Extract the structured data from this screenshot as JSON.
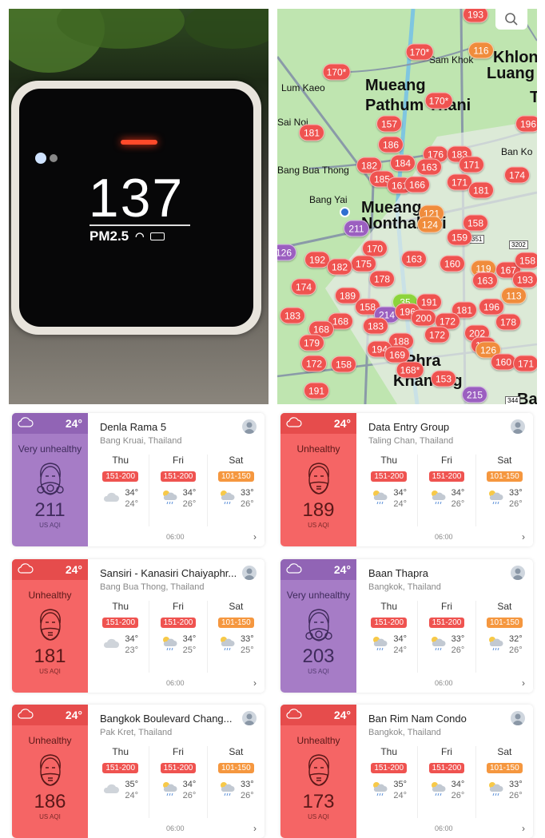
{
  "photo": {
    "reading": "137",
    "pollutant": "PM2.5"
  },
  "map": {
    "search_icon": "search-icon",
    "colors": {
      "red": "#ef5350",
      "orange": "#f08c3c",
      "purple": "#9b5fc0",
      "green": "#8cd43c"
    },
    "labels": [
      "Mueang",
      "Pathum Thani",
      "Lum Kaeo",
      "Sai Noi",
      "Sam Khok",
      "Khlong",
      "Luang",
      "Bang Bua Thong",
      "Bang Yai",
      "Mueang",
      "Nonthaburi",
      "Ban Ko",
      "Phra",
      "Khanong",
      "Ba",
      "T"
    ],
    "road_numbers": [
      "351",
      "3202",
      "344"
    ],
    "markers": [
      {
        "v": "193",
        "c": "red"
      },
      {
        "v": "170*",
        "c": "red"
      },
      {
        "v": "116",
        "c": "orange"
      },
      {
        "v": "170*",
        "c": "red"
      },
      {
        "v": "170*",
        "c": "red"
      },
      {
        "v": "157",
        "c": "red"
      },
      {
        "v": "181",
        "c": "red"
      },
      {
        "v": "196",
        "c": "red"
      },
      {
        "v": "186",
        "c": "red"
      },
      {
        "v": "182",
        "c": "red"
      },
      {
        "v": "176",
        "c": "red"
      },
      {
        "v": "183",
        "c": "red"
      },
      {
        "v": "184",
        "c": "red"
      },
      {
        "v": "163",
        "c": "red"
      },
      {
        "v": "171",
        "c": "red"
      },
      {
        "v": "174",
        "c": "red"
      },
      {
        "v": "185",
        "c": "red"
      },
      {
        "v": "161",
        "c": "red"
      },
      {
        "v": "166",
        "c": "red"
      },
      {
        "v": "171",
        "c": "red"
      },
      {
        "v": "181",
        "c": "red"
      },
      {
        "v": "121",
        "c": "orange"
      },
      {
        "v": "211",
        "c": "purple"
      },
      {
        "v": "124",
        "c": "orange"
      },
      {
        "v": "158",
        "c": "red"
      },
      {
        "v": "159",
        "c": "red"
      },
      {
        "v": "126",
        "c": "purple"
      },
      {
        "v": "170",
        "c": "red"
      },
      {
        "v": "192",
        "c": "red"
      },
      {
        "v": "175",
        "c": "red"
      },
      {
        "v": "182",
        "c": "red"
      },
      {
        "v": "163",
        "c": "red"
      },
      {
        "v": "160",
        "c": "red"
      },
      {
        "v": "119",
        "c": "orange"
      },
      {
        "v": "167",
        "c": "red"
      },
      {
        "v": "158",
        "c": "red"
      },
      {
        "v": "193",
        "c": "red"
      },
      {
        "v": "174",
        "c": "red"
      },
      {
        "v": "178",
        "c": "red"
      },
      {
        "v": "163",
        "c": "red"
      },
      {
        "v": "189",
        "c": "red"
      },
      {
        "v": "113",
        "c": "orange"
      },
      {
        "v": "35",
        "c": "green"
      },
      {
        "v": "191",
        "c": "red"
      },
      {
        "v": "158",
        "c": "red"
      },
      {
        "v": "214",
        "c": "purple"
      },
      {
        "v": "196",
        "c": "red"
      },
      {
        "v": "181",
        "c": "red"
      },
      {
        "v": "196",
        "c": "red"
      },
      {
        "v": "183",
        "c": "red"
      },
      {
        "v": "168",
        "c": "red"
      },
      {
        "v": "200",
        "c": "red"
      },
      {
        "v": "172",
        "c": "red"
      },
      {
        "v": "178",
        "c": "red"
      },
      {
        "v": "168",
        "c": "red"
      },
      {
        "v": "183",
        "c": "red"
      },
      {
        "v": "179",
        "c": "red"
      },
      {
        "v": "172",
        "c": "red"
      },
      {
        "v": "202",
        "c": "red"
      },
      {
        "v": "192",
        "c": "red"
      },
      {
        "v": "188",
        "c": "red"
      },
      {
        "v": "194",
        "c": "red"
      },
      {
        "v": "169",
        "c": "red"
      },
      {
        "v": "126",
        "c": "orange"
      },
      {
        "v": "172",
        "c": "red"
      },
      {
        "v": "158",
        "c": "red"
      },
      {
        "v": "160",
        "c": "red"
      },
      {
        "v": "171",
        "c": "red"
      },
      {
        "v": "168*",
        "c": "red"
      },
      {
        "v": "153",
        "c": "red"
      },
      {
        "v": "191",
        "c": "red"
      },
      {
        "v": "215",
        "c": "purple"
      }
    ]
  },
  "aqi_colors": {
    "151-200": "#ef5350",
    "101-150": "#f5973f"
  },
  "cards": [
    {
      "temp": "24°",
      "status": "Very unhealthy",
      "level": "purple",
      "aqi": "211",
      "unit": "US AQI",
      "name": "Denla Rama 5",
      "location": "Bang Kruai, Thailand",
      "time": "06:00",
      "days": [
        {
          "d": "Thu",
          "r": "151-200",
          "hi": "34°",
          "lo": "24°",
          "wx": "cloud"
        },
        {
          "d": "Fri",
          "r": "151-200",
          "hi": "34°",
          "lo": "26°",
          "wx": "sun-rain"
        },
        {
          "d": "Sat",
          "r": "101-150",
          "hi": "33°",
          "lo": "26°",
          "wx": "sun-rain"
        }
      ]
    },
    {
      "temp": "24°",
      "status": "Unhealthy",
      "level": "red",
      "aqi": "189",
      "unit": "US AQI",
      "name": "Data Entry Group",
      "location": "Taling Chan, Thailand",
      "time": "06:00",
      "days": [
        {
          "d": "Thu",
          "r": "151-200",
          "hi": "34°",
          "lo": "24°",
          "wx": "sun-rain"
        },
        {
          "d": "Fri",
          "r": "151-200",
          "hi": "34°",
          "lo": "26°",
          "wx": "sun-rain"
        },
        {
          "d": "Sat",
          "r": "101-150",
          "hi": "33°",
          "lo": "26°",
          "wx": "sun-rain"
        }
      ]
    },
    {
      "temp": "24°",
      "status": "Unhealthy",
      "level": "red",
      "aqi": "181",
      "unit": "US AQI",
      "name": "Sansiri - Kanasiri Chaiyaphr...",
      "location": "Bang Bua Thong, Thailand",
      "time": "06:00",
      "days": [
        {
          "d": "Thu",
          "r": "151-200",
          "hi": "34°",
          "lo": "23°",
          "wx": "cloud"
        },
        {
          "d": "Fri",
          "r": "151-200",
          "hi": "34°",
          "lo": "25°",
          "wx": "sun-rain"
        },
        {
          "d": "Sat",
          "r": "101-150",
          "hi": "33°",
          "lo": "25°",
          "wx": "sun-rain"
        }
      ]
    },
    {
      "temp": "24°",
      "status": "Very unhealthy",
      "level": "purple",
      "aqi": "203",
      "unit": "US AQI",
      "name": "Baan Thapra",
      "location": "Bangkok, Thailand",
      "time": "06:00",
      "days": [
        {
          "d": "Thu",
          "r": "151-200",
          "hi": "34°",
          "lo": "24°",
          "wx": "sun-rain"
        },
        {
          "d": "Fri",
          "r": "151-200",
          "hi": "33°",
          "lo": "26°",
          "wx": "sun-rain"
        },
        {
          "d": "Sat",
          "r": "101-150",
          "hi": "32°",
          "lo": "26°",
          "wx": "sun-rain"
        }
      ]
    },
    {
      "temp": "24°",
      "status": "Unhealthy",
      "level": "red",
      "aqi": "186",
      "unit": "US AQI",
      "name": "Bangkok Boulevard Chang...",
      "location": "Pak Kret, Thailand",
      "time": "06:00",
      "days": [
        {
          "d": "Thu",
          "r": "151-200",
          "hi": "35°",
          "lo": "24°",
          "wx": "cloud"
        },
        {
          "d": "Fri",
          "r": "151-200",
          "hi": "34°",
          "lo": "26°",
          "wx": "sun-rain"
        },
        {
          "d": "Sat",
          "r": "101-150",
          "hi": "33°",
          "lo": "26°",
          "wx": "sun-rain"
        }
      ]
    },
    {
      "temp": "24°",
      "status": "Unhealthy",
      "level": "red",
      "aqi": "173",
      "unit": "US AQI",
      "name": "Ban Rim Nam Condo",
      "location": "Bangkok, Thailand",
      "time": "06:00",
      "days": [
        {
          "d": "Thu",
          "r": "151-200",
          "hi": "35°",
          "lo": "24°",
          "wx": "sun-rain"
        },
        {
          "d": "Fri",
          "r": "151-200",
          "hi": "34°",
          "lo": "26°",
          "wx": "sun-rain"
        },
        {
          "d": "Sat",
          "r": "101-150",
          "hi": "33°",
          "lo": "26°",
          "wx": "sun-rain"
        }
      ]
    }
  ]
}
